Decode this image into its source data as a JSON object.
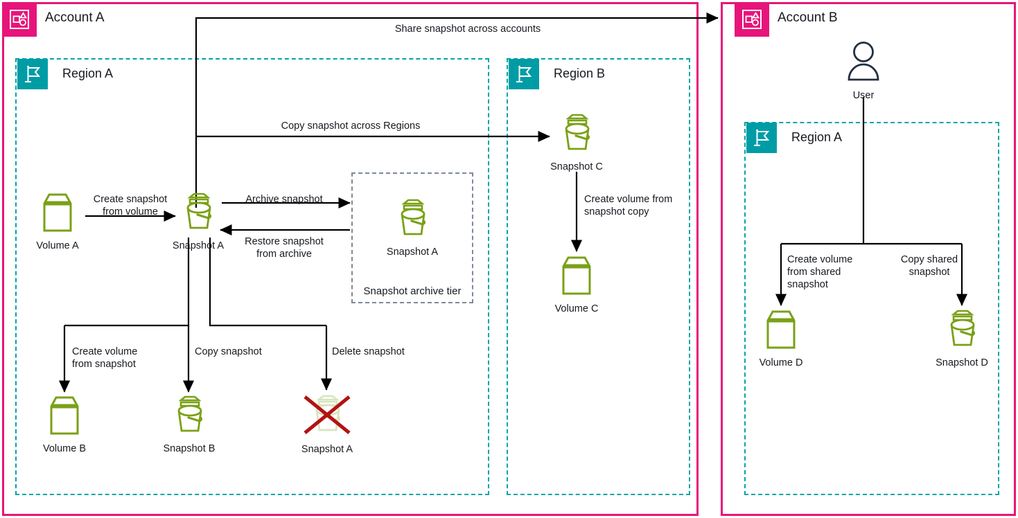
{
  "accounts": [
    {
      "id": "account-a",
      "title": "Account A",
      "icon": "account-icon",
      "color": "#E7157B"
    },
    {
      "id": "account-b",
      "title": "Account B",
      "icon": "account-icon",
      "color": "#E7157B"
    }
  ],
  "regions": [
    {
      "id": "region-a-acct-a",
      "title": "Region A",
      "icon": "region-flag-icon",
      "color": "#009CA6"
    },
    {
      "id": "region-b-acct-a",
      "title": "Region B",
      "icon": "region-flag-icon",
      "color": "#009CA6"
    },
    {
      "id": "region-a-acct-b",
      "title": "Region A",
      "icon": "region-flag-icon",
      "color": "#009CA6"
    }
  ],
  "archive": {
    "label": "Snapshot archive tier",
    "border_color": "#7D8998"
  },
  "nodes": {
    "volume_a": {
      "label": "Volume A",
      "icon": "volume-icon"
    },
    "snapshot_a": {
      "label": "Snapshot A",
      "icon": "snapshot-icon"
    },
    "snapshot_a_archived": {
      "label": "Snapshot A",
      "icon": "snapshot-icon"
    },
    "volume_b": {
      "label": "Volume B",
      "icon": "volume-icon"
    },
    "snapshot_b": {
      "label": "Snapshot B",
      "icon": "snapshot-icon"
    },
    "snapshot_a_deleted": {
      "label": "Snapshot A",
      "icon": "snapshot-deleted-icon"
    },
    "snapshot_c": {
      "label": "Snapshot C",
      "icon": "snapshot-icon"
    },
    "volume_c": {
      "label": "Volume C",
      "icon": "volume-icon"
    },
    "user": {
      "label": "User",
      "icon": "user-icon"
    },
    "volume_d": {
      "label": "Volume D",
      "icon": "volume-icon"
    },
    "snapshot_d": {
      "label": "Snapshot D",
      "icon": "snapshot-icon"
    }
  },
  "edges": {
    "share_across_accounts": "Share snapshot across accounts",
    "copy_across_regions": "Copy snapshot across Regions",
    "create_snapshot_from_volume": "Create snapshot\nfrom volume",
    "archive_snapshot": "Archive snapshot",
    "restore_snapshot_from_archive": "Restore snapshot\nfrom archive",
    "create_volume_from_snapshot": "Create volume\nfrom snapshot",
    "copy_snapshot": "Copy snapshot",
    "delete_snapshot": "Delete snapshot",
    "create_volume_from_snapshot_copy": "Create volume from\nsnapshot copy",
    "create_volume_from_shared_snapshot": "Create volume\nfrom shared\nsnapshot",
    "copy_shared_snapshot": "Copy shared\nsnapshot"
  },
  "palette": {
    "account_border": "#E7157B",
    "region_border": "#00A4A6",
    "region_badge": "#009CA6",
    "resource_green": "#7AA116",
    "deleted_x": "#B31212",
    "user_icon": "#232F3E",
    "line": "#000000"
  }
}
